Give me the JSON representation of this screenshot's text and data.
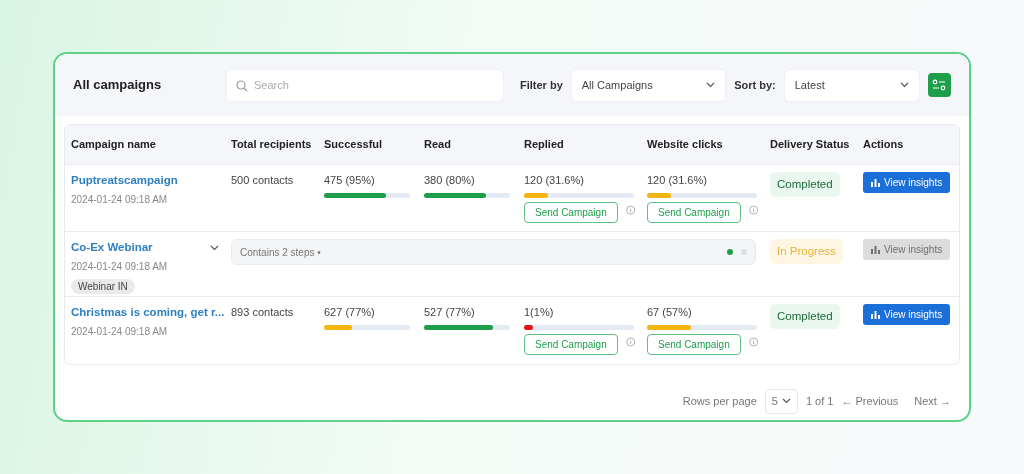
{
  "title": "All campaigns",
  "search": {
    "placeholder": "Search"
  },
  "filter": {
    "label": "Filter by",
    "value": "All Campaigns"
  },
  "sort": {
    "label": "Sort by:",
    "value": "Latest"
  },
  "table": {
    "columns": [
      "Campaign name",
      "Total recipients",
      "Successful",
      "Read",
      "Replied",
      "Website clicks",
      "Delivery Status",
      "Actions"
    ],
    "rows": [
      {
        "kind": "metrics",
        "name": "Puptreatscampaign",
        "date": "2024-01-24 09:18 AM",
        "recipients": "500 contacts",
        "metrics": [
          {
            "value": "475 (95%)",
            "level": 0.72,
            "color": "#1e9e4a"
          },
          {
            "value": "380 (80%)",
            "level": 0.72,
            "color": "#1e9e4a"
          },
          {
            "value": "120 (31.6%)",
            "level": 0.22,
            "color": "#f5b50f",
            "button": "Send Campaign"
          },
          {
            "value": "120 (31.6%)",
            "level": 0.22,
            "color": "#f5b50f",
            "button": "Send Campaign"
          }
        ],
        "status": {
          "text": "Completed",
          "kind": "completed"
        },
        "action": {
          "label": "View insights",
          "disabled": false
        }
      },
      {
        "kind": "steps",
        "name": "Co-Ex Webinar",
        "date": "2024-01-24 09:18 AM",
        "tag": "Webinar IN",
        "expanded": false,
        "steps_text": "Contains 2 steps •",
        "steps": [
          {
            "done": true
          },
          {
            "done": false
          }
        ],
        "status": {
          "text": "In Progress",
          "kind": "progress"
        },
        "action": {
          "label": "View insights",
          "disabled": true
        }
      },
      {
        "kind": "metrics",
        "name": "Christmas is coming, get r...",
        "date": "2024-01-24 09:18 AM",
        "recipients": "893 contacts",
        "metrics": [
          {
            "value": "627 (77%)",
            "level": 0.33,
            "color": "#f5b50f"
          },
          {
            "value": "527 (77%)",
            "level": 0.8,
            "color": "#1e9e4a"
          },
          {
            "value": "1(1%)",
            "level": 0.08,
            "color": "#e0151b",
            "button": "Send Campaign"
          },
          {
            "value": "67 (57%)",
            "level": 0.4,
            "color": "#f5b50f",
            "button": "Send Campaign"
          }
        ],
        "status": {
          "text": "Completed",
          "kind": "completed"
        },
        "action": {
          "label": "View insights",
          "disabled": false
        }
      }
    ]
  },
  "pagination": {
    "rows_label": "Rows per page",
    "rows_value": "5",
    "page": "1 of 1",
    "previous": "← Previous",
    "next": "Next →"
  }
}
